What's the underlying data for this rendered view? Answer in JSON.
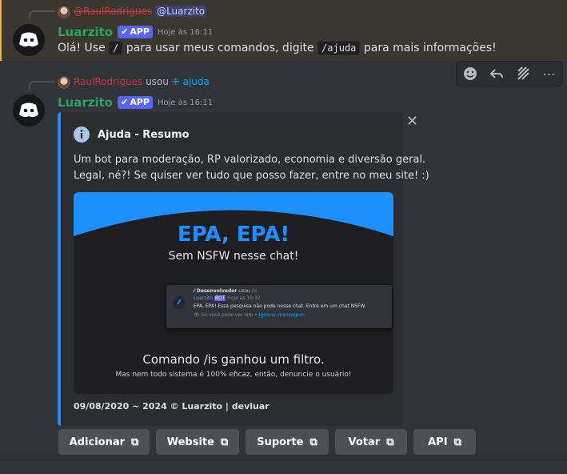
{
  "message1": {
    "reply_author": "@RaulRodrigues",
    "reply_mention": "@Luarzito",
    "bot_name": "Luarzito",
    "badge": "APP",
    "timestamp": "Hoje às 16:11",
    "text_before": "Olá! Use",
    "code1": "/",
    "text_middle": "para usar meus comandos, digite",
    "code2": "/ajuda",
    "text_after": "para mais informações!"
  },
  "message2": {
    "reply_author": "RaulRodrigues",
    "reply_used": "usou",
    "command": "ajuda",
    "bot_name": "Luarzito",
    "badge": "APP",
    "timestamp": "Hoje às 16:11"
  },
  "toolbar": {
    "icons": [
      "add-reaction-icon",
      "reply-icon",
      "threads-icon",
      "more-icon"
    ]
  },
  "embed": {
    "title": "Ajuda - Resumo",
    "description_line1": "Um bot para moderação, RP valorizado, economia e diversão geral.",
    "description_line2": "Legal, né?! Se quiser ver tudo que posso fazer, entre no meu site! :)",
    "accent": "#1e8fff",
    "footer": "09/08/2020 ~ 2024 © Luarzito | devluar",
    "image": {
      "headline": "EPA, EPA!",
      "subheadline": "Sem NSFW nesse chat!",
      "preview_user": "Desenvolvedor",
      "preview_used": "usou",
      "preview_cmd": "/is",
      "preview_bot": "Luarzito",
      "preview_badge": "BOT",
      "preview_time": "Hoje às 19:32",
      "preview_text": "EPA, EPA! Essa pesquisa não pode nesse chat. Entre em um chat NSFW.",
      "preview_note": "Só você pode ver isto •",
      "preview_note_link": "Ignorar mensagem",
      "caption": "Comando /is ganhou um filtro.",
      "subcaption": "Mas nem todo sistema é 100% eficaz, então, denuncie o usuário!"
    }
  },
  "buttons": [
    {
      "label": "Adicionar"
    },
    {
      "label": "Website"
    },
    {
      "label": "Suporte"
    },
    {
      "label": "Votar"
    },
    {
      "label": "API"
    }
  ],
  "colors": {
    "background": "#313338",
    "bot_name": "#23a55a",
    "badge": "#5865f2",
    "highlight_bar": "#f0b232"
  }
}
